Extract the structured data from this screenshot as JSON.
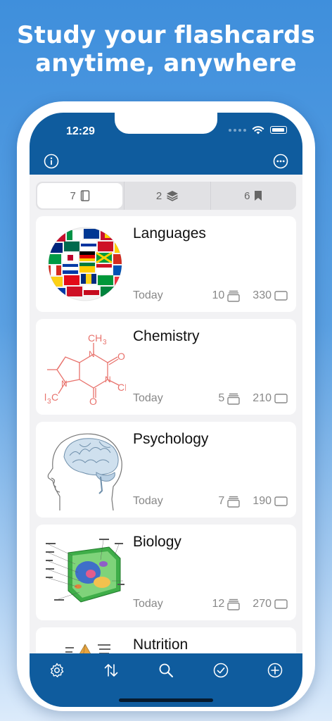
{
  "promo": {
    "line1": "Study your flashcards",
    "line2": "anytime, anywhere"
  },
  "status": {
    "time": "12:29"
  },
  "nav": {
    "left_icon": "info-icon",
    "right_icon": "more-icon"
  },
  "segments": [
    {
      "count": "7",
      "icon": "book-icon",
      "selected": true
    },
    {
      "count": "2",
      "icon": "stack-icon",
      "selected": false
    },
    {
      "count": "6",
      "icon": "bookmark-icon",
      "selected": false
    }
  ],
  "decks": [
    {
      "title": "Languages",
      "date": "Today",
      "sets": "10",
      "cards": "330",
      "image": "flag-globe"
    },
    {
      "title": "Chemistry",
      "date": "Today",
      "sets": "5",
      "cards": "210",
      "image": "caffeine-molecule"
    },
    {
      "title": "Psychology",
      "date": "Today",
      "sets": "7",
      "cards": "190",
      "image": "brain-profile"
    },
    {
      "title": "Biology",
      "date": "Today",
      "sets": "12",
      "cards": "270",
      "image": "plant-cell"
    },
    {
      "title": "Nutrition",
      "image": "food-pyramid"
    }
  ],
  "tabbar": [
    "settings-icon",
    "sort-icon",
    "search-icon",
    "checkmark-icon",
    "add-icon"
  ],
  "colors": {
    "bar": "#0f5c9e",
    "background_top": "#3f8fdc",
    "molecule": "#e8736d"
  }
}
